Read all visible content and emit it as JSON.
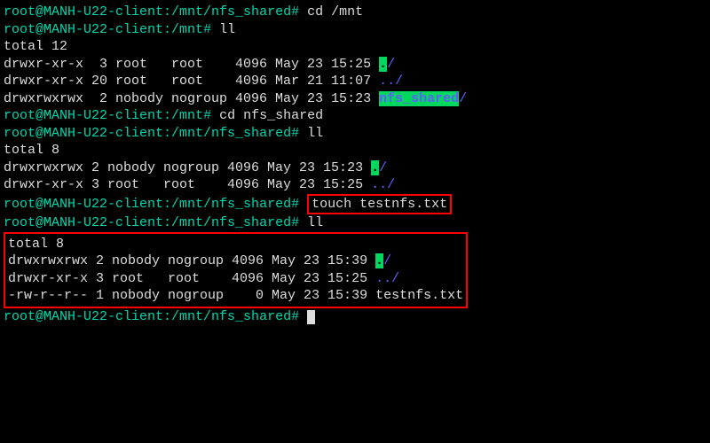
{
  "prompts": {
    "p1_user": "root@MANH-U22-client",
    "p1_path": "/mnt/nfs_shared",
    "p1_cmd": "cd /mnt",
    "p2_user": "root@MANH-U22-client",
    "p2_path": "/mnt",
    "p2_cmd": "ll",
    "p3_user": "root@MANH-U22-client",
    "p3_path": "/mnt",
    "p3_cmd": "cd nfs_shared",
    "p4_user": "root@MANH-U22-client",
    "p4_path": "/mnt/nfs_shared",
    "p4_cmd": "ll",
    "p5_user": "root@MANH-U22-client",
    "p5_path": "/mnt/nfs_shared",
    "p5_cmd": "touch testnfs.txt",
    "p6_user": "root@MANH-U22-client",
    "p6_path": "/mnt/nfs_shared",
    "p6_cmd": "ll",
    "p7_user": "root@MANH-U22-client",
    "p7_path": "/mnt/nfs_shared"
  },
  "listing1": {
    "total": "total 12",
    "row1": "drwxr-xr-x  3 root   root    4096 May 23 15:25 ",
    "row1_dir": ".",
    "row1_sl": "/",
    "row2": "drwxr-xr-x 20 root   root    4096 Mar 21 11:07 ",
    "row2_dir": "..",
    "row2_sl": "/",
    "row3": "drwxrwxrwx  2 nobody nogroup 4096 May 23 15:23 ",
    "row3_dir": "nfs_shared",
    "row3_sl": "/"
  },
  "listing2": {
    "total": "total 8",
    "row1": "drwxrwxrwx 2 nobody nogroup 4096 May 23 15:23 ",
    "row1_dir": ".",
    "row1_sl": "/",
    "row2": "drwxr-xr-x 3 root   root    4096 May 23 15:25 ",
    "row2_dir": "..",
    "row2_sl": "/"
  },
  "listing3": {
    "total": "total 8",
    "row1": "drwxrwxrwx 2 nobody nogroup 4096 May 23 15:39 ",
    "row1_dir": ".",
    "row1_sl": "/",
    "row2": "drwxr-xr-x 3 root   root    4096 May 23 15:25 ",
    "row2_dir": "..",
    "row2_sl": "/",
    "row3": "-rw-r--r-- 1 nobody nogroup    0 May 23 15:39 testnfs.txt"
  }
}
